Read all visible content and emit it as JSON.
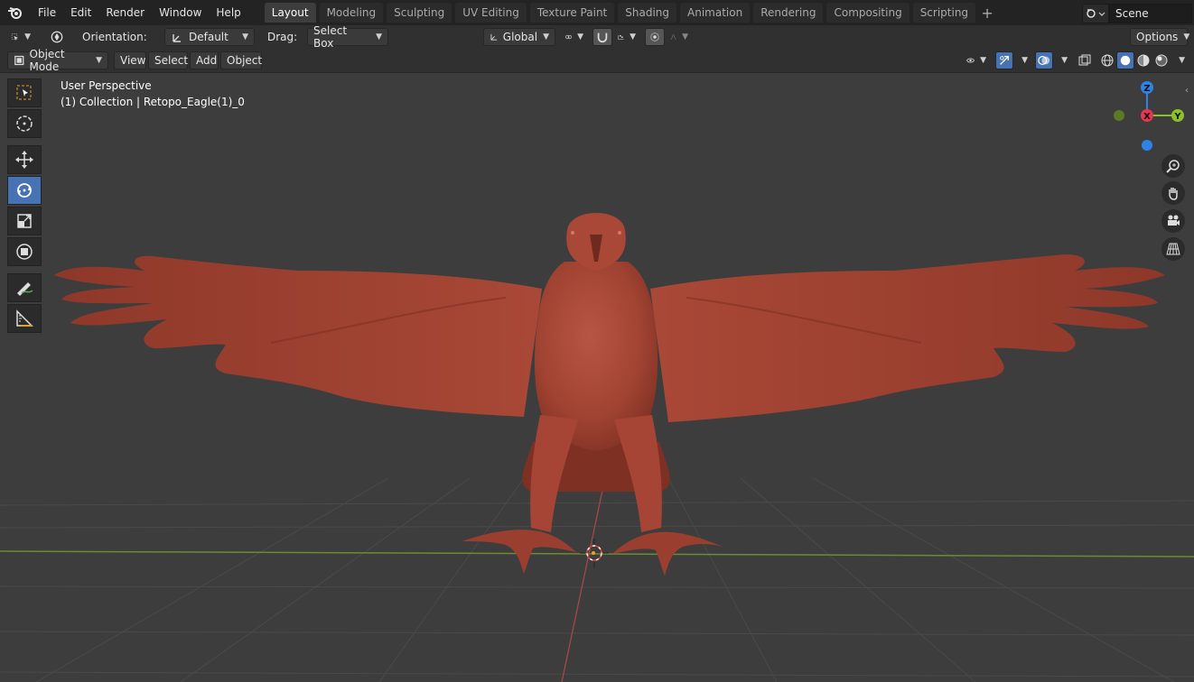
{
  "menu": [
    "File",
    "Edit",
    "Render",
    "Window",
    "Help"
  ],
  "workspaces": [
    {
      "label": "Layout",
      "active": true
    },
    {
      "label": "Modeling",
      "active": false
    },
    {
      "label": "Sculpting",
      "active": false
    },
    {
      "label": "UV Editing",
      "active": false
    },
    {
      "label": "Texture Paint",
      "active": false
    },
    {
      "label": "Shading",
      "active": false
    },
    {
      "label": "Animation",
      "active": false
    },
    {
      "label": "Rendering",
      "active": false
    },
    {
      "label": "Compositing",
      "active": false
    },
    {
      "label": "Scripting",
      "active": false
    }
  ],
  "scene": {
    "name": "Scene"
  },
  "tool_header": {
    "orientation_label": "Orientation:",
    "orientation_value": "Default",
    "drag_label": "Drag:",
    "drag_value": "Select Box",
    "transform_orientation": "Global",
    "options_label": "Options"
  },
  "view_header": {
    "mode": "Object Mode",
    "menus": [
      "View",
      "Select",
      "Add",
      "Object"
    ]
  },
  "viewport": {
    "perspective": "User Perspective",
    "collection": "(1) Collection | Retopo_Eagle(1)_0"
  },
  "gizmo": {
    "x": "X",
    "y": "Y",
    "z": "Z"
  },
  "colors": {
    "x_axis": "#e8364f",
    "y_axis": "#8ac325",
    "z_axis": "#2e84e6",
    "accent": "#4772b3",
    "model": "#a64535"
  }
}
